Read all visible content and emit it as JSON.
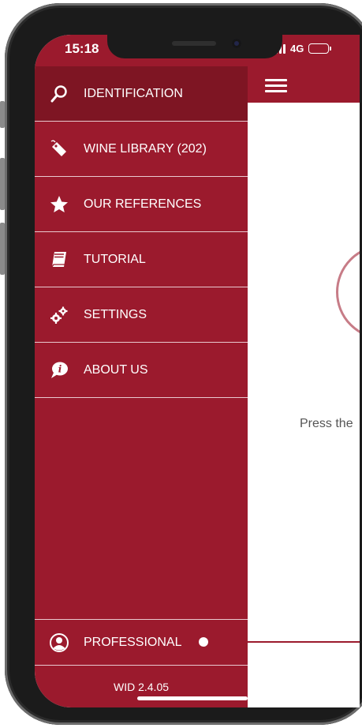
{
  "status_bar": {
    "time": "15:18",
    "network": "4G"
  },
  "menu": {
    "items": [
      {
        "label": "IDENTIFICATION",
        "icon": "magnifier-icon"
      },
      {
        "label": "WINE LIBRARY (202)",
        "icon": "tag-icon"
      },
      {
        "label": "OUR REFERENCES",
        "icon": "star-icon"
      },
      {
        "label": "TUTORIAL",
        "icon": "book-icon"
      },
      {
        "label": "SETTINGS",
        "icon": "gears-icon"
      },
      {
        "label": "ABOUT US",
        "icon": "info-bubble-icon"
      }
    ],
    "active_index": 0
  },
  "professional": {
    "label": "PROFESSIONAL",
    "toggle_on": false
  },
  "version": "WID 2.4.05",
  "main": {
    "hint_text": "Press the"
  },
  "colors": {
    "brand": "#9b1a2d",
    "active": "#7e1523",
    "divider": "#e9c9cf"
  }
}
